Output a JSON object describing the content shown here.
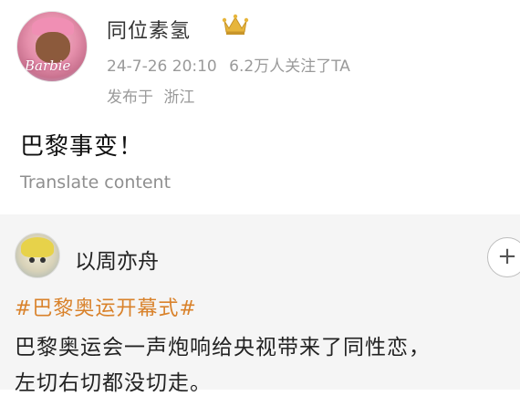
{
  "post": {
    "username": "同位素氢",
    "badge_icon": "crown-icon",
    "avatar_text": "Barbie",
    "date": "24-7-26 20:10",
    "followers": "6.2万人关注了TA",
    "location_prefix": "发布于",
    "location": "浙江",
    "text": "巴黎事变！",
    "translate_label": "Translate content"
  },
  "repost": {
    "username": "以周亦舟",
    "follow_symbol": "+",
    "hashtag": "#巴黎奥运开幕式#",
    "line1": "巴黎奥运会一声炮响给央视带来了同性恋，",
    "line2": "左切右切都没切走。"
  },
  "colors": {
    "hashtag": "#d9822b",
    "meta_text": "#9a9a9a",
    "repost_background": "#f5f5f5"
  }
}
